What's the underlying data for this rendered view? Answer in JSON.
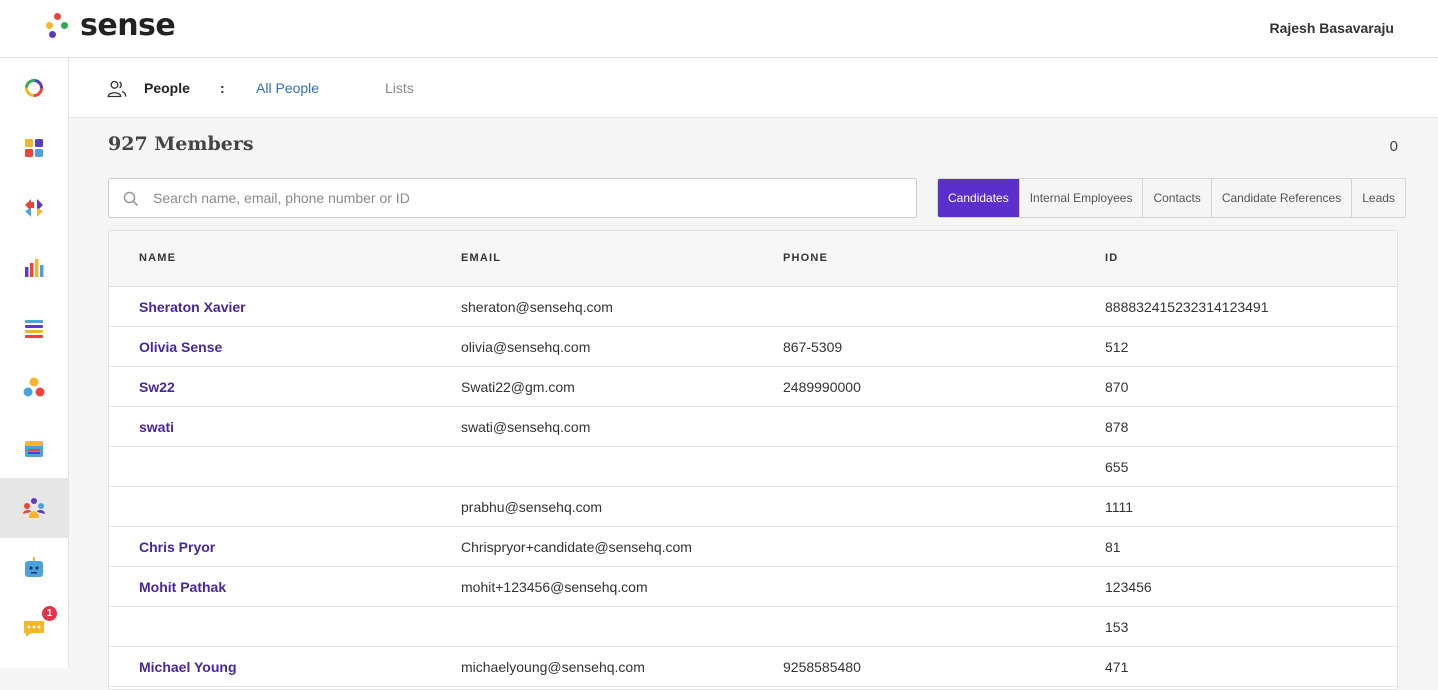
{
  "app": {
    "brand": "sense",
    "user_name": "Rajesh Basavaraju"
  },
  "colors": {
    "accent": "#5a2fcb",
    "link": "#2f6ec2",
    "name_link": "#4527a0",
    "badge": "#e0364a"
  },
  "sidebar": {
    "items": [
      {
        "icon": "ring-icon"
      },
      {
        "icon": "grid-icon"
      },
      {
        "icon": "arrows-icon"
      },
      {
        "icon": "bar-chart-icon"
      },
      {
        "icon": "list-icon"
      },
      {
        "icon": "nodes-icon"
      },
      {
        "icon": "calendar-icon"
      },
      {
        "icon": "people-icon",
        "active": true
      },
      {
        "icon": "bot-icon"
      },
      {
        "icon": "chat-icon",
        "badge": "1"
      }
    ]
  },
  "subheader": {
    "section": "People",
    "separator": ":",
    "tabs": [
      {
        "label": "All People",
        "active": true
      },
      {
        "label": "Lists",
        "active": false
      }
    ]
  },
  "members": {
    "title": "927 Members",
    "count": "0"
  },
  "search": {
    "placeholder": "Search name, email, phone number or ID",
    "value": ""
  },
  "filters": [
    {
      "label": "Candidates",
      "active": true
    },
    {
      "label": "Internal Employees",
      "active": false
    },
    {
      "label": "Contacts",
      "active": false
    },
    {
      "label": "Candidate References",
      "active": false
    },
    {
      "label": "Leads",
      "active": false
    }
  ],
  "table": {
    "columns": [
      "NAME",
      "EMAIL",
      "PHONE",
      "ID"
    ],
    "rows": [
      {
        "name": "Sheraton Xavier",
        "email": "sheraton@sensehq.com",
        "phone": "",
        "id": "888832415232314123491"
      },
      {
        "name": "Olivia Sense",
        "email": "olivia@sensehq.com",
        "phone": "867-5309",
        "id": "512"
      },
      {
        "name": "Sw22",
        "email": "Swati22@gm.com",
        "phone": "2489990000",
        "id": "870"
      },
      {
        "name": "swati",
        "email": "swati@sensehq.com",
        "phone": "",
        "id": "878"
      },
      {
        "name": "",
        "email": "",
        "phone": "",
        "id": "655"
      },
      {
        "name": "",
        "email": "prabhu@sensehq.com",
        "phone": "",
        "id": "1111"
      },
      {
        "name": "Chris Pryor",
        "email": "Chrispryor+candidate@sensehq.com",
        "phone": "",
        "id": "81"
      },
      {
        "name": "Mohit Pathak",
        "email": "mohit+123456@sensehq.com",
        "phone": "",
        "id": "123456"
      },
      {
        "name": "",
        "email": "",
        "phone": "",
        "id": "153"
      },
      {
        "name": "Michael Young",
        "email": "michaelyoung@sensehq.com",
        "phone": "9258585480",
        "id": "471"
      }
    ]
  }
}
